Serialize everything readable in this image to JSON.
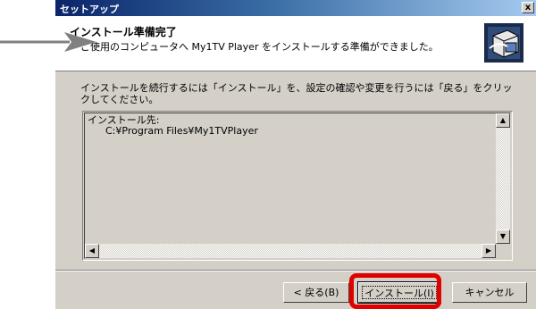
{
  "window": {
    "title": "セットアップ",
    "close_glyph": "x"
  },
  "header": {
    "title": "インストール準備完了",
    "subtitle": "ご使用のコンピュータへ My1TV Player をインストールする準備ができました。",
    "logo_icon": "setup-install-icon"
  },
  "instruction": "インストールを続行するには「インストール」を、設定の確認や変更を行うには「戻る」をクリックしてください。",
  "summary": {
    "label": "インストール先:",
    "path": "C:¥Program Files¥My1TVPlayer"
  },
  "buttons": {
    "back": "< 戻る(B)",
    "install": "インストール(I)",
    "cancel": "キャンセル"
  },
  "annotation": {
    "arrow_color": "#808080",
    "highlight_color": "#e00000"
  }
}
